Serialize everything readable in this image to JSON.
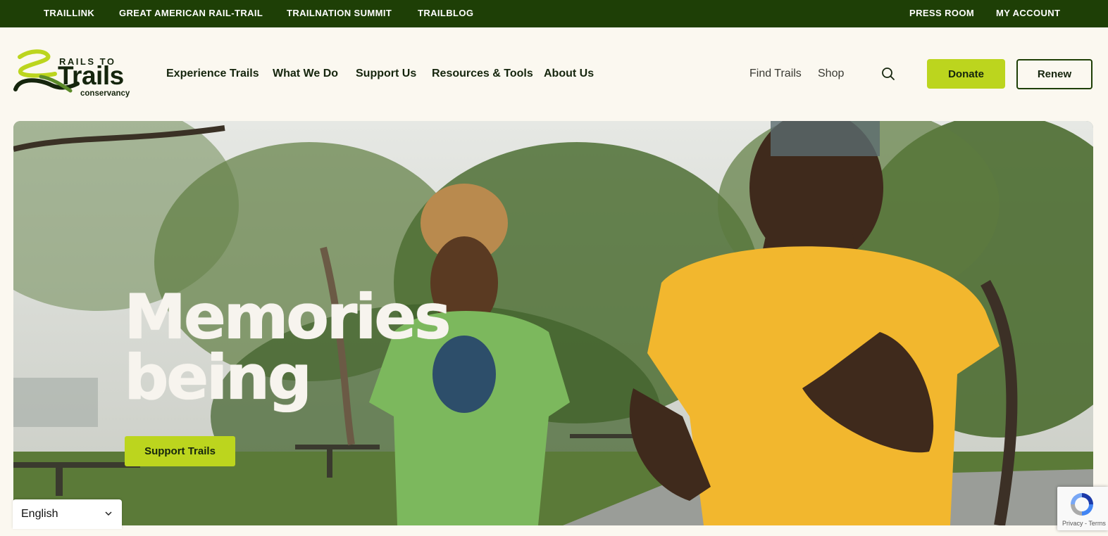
{
  "topbar": {
    "links": [
      "TRAILLINK",
      "GREAT AMERICAN RAIL-TRAIL",
      "TRAILNATION SUMMIT",
      "TRAILBLOG"
    ],
    "right_links": [
      "PRESS ROOM",
      "MY ACCOUNT"
    ]
  },
  "logo": {
    "line1": "RAILS TO",
    "line2": "Trails",
    "line3": "conservancy"
  },
  "nav": {
    "main": [
      "Experience Trails",
      "What We Do",
      "Support Us",
      "Resources & Tools",
      "About Us"
    ],
    "secondary": [
      "Find Trails",
      "Shop"
    ],
    "search_icon": "search-icon",
    "donate_label": "Donate",
    "renew_label": "Renew"
  },
  "hero": {
    "title_line1": "Memories",
    "title_line2": "being",
    "cta_label": "Support Trails"
  },
  "language": {
    "selected": "English",
    "icon": "chevron-down-icon"
  },
  "recaptcha": {
    "text": "Privacy - Terms"
  },
  "colors": {
    "topbar_bg": "#1e3f06",
    "page_bg": "#fbf8f0",
    "accent": "#bcd51e",
    "text_dark": "#15250d"
  }
}
